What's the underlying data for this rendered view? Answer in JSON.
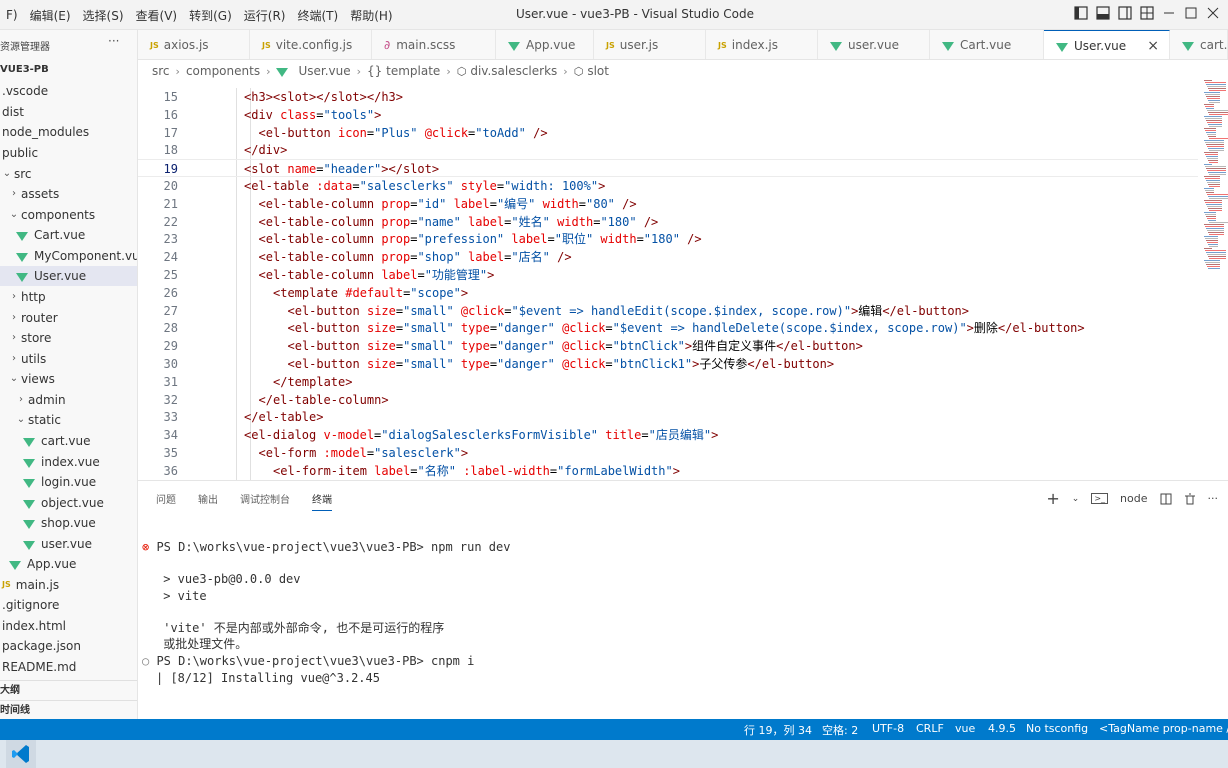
{
  "menu": [
    "F)",
    "编辑(E)",
    "选择(S)",
    "查看(V)",
    "转到(G)",
    "运行(R)",
    "终端(T)",
    "帮助(H)"
  ],
  "window_title": "User.vue - vue3-PB - Visual Studio Code",
  "sidebar": {
    "title": "资源管理器",
    "more": "···",
    "items": [
      {
        "label": "VUE3-PB",
        "kind": "root"
      },
      {
        "label": ".vscode",
        "kind": "folder"
      },
      {
        "label": "dist",
        "kind": "folder"
      },
      {
        "label": "node_modules",
        "kind": "folder"
      },
      {
        "label": "public",
        "kind": "folder"
      },
      {
        "label": "src",
        "kind": "folder"
      },
      {
        "label": "assets",
        "kind": "folder"
      },
      {
        "label": "components",
        "kind": "folder"
      },
      {
        "label": "Cart.vue",
        "kind": "vue"
      },
      {
        "label": "MyComponent.vue",
        "kind": "vue"
      },
      {
        "label": "User.vue",
        "kind": "vue"
      },
      {
        "label": "http",
        "kind": "folder"
      },
      {
        "label": "router",
        "kind": "folder"
      },
      {
        "label": "store",
        "kind": "folder"
      },
      {
        "label": "utils",
        "kind": "folder"
      },
      {
        "label": "views",
        "kind": "folder"
      },
      {
        "label": "admin",
        "kind": "folder"
      },
      {
        "label": "static",
        "kind": "folder"
      },
      {
        "label": "cart.vue",
        "kind": "vue"
      },
      {
        "label": "index.vue",
        "kind": "vue"
      },
      {
        "label": "login.vue",
        "kind": "vue"
      },
      {
        "label": "object.vue",
        "kind": "vue"
      },
      {
        "label": "shop.vue",
        "kind": "vue"
      },
      {
        "label": "user.vue",
        "kind": "vue"
      },
      {
        "label": "App.vue",
        "kind": "vue"
      },
      {
        "label": "main.js",
        "kind": "js"
      },
      {
        "label": ".gitignore",
        "kind": "file"
      },
      {
        "label": "index.html",
        "kind": "file"
      },
      {
        "label": "package.json",
        "kind": "file"
      },
      {
        "label": "README.md",
        "kind": "file"
      }
    ],
    "outline": "大纲",
    "timeline": "时间线"
  },
  "tabs": [
    {
      "label": "axios.js",
      "icon": "JS"
    },
    {
      "label": "vite.config.js",
      "icon": "JS"
    },
    {
      "label": "main.scss",
      "icon": "scss"
    },
    {
      "label": "App.vue",
      "icon": "vue"
    },
    {
      "label": "user.js",
      "icon": "JS"
    },
    {
      "label": "index.js",
      "icon": "JS"
    },
    {
      "label": "user.vue",
      "icon": "vue"
    },
    {
      "label": "Cart.vue",
      "icon": "vue"
    },
    {
      "label": "User.vue",
      "icon": "vue",
      "active": true
    },
    {
      "label": "cart.v",
      "icon": "vue"
    }
  ],
  "breadcrumb": [
    "src",
    "components",
    "User.vue",
    "{} template",
    "div.salesclerks",
    "slot"
  ],
  "code": [
    {
      "n": "15",
      "text": "<h3><slot></slot></h3>",
      "indent": 3
    },
    {
      "n": "16",
      "text": "<div class=\"tools\">",
      "indent": 3
    },
    {
      "n": "17",
      "text": "<el-button icon=\"Plus\" @click=\"toAdd\" />",
      "indent": 4
    },
    {
      "n": "18",
      "text": "</div>",
      "indent": 3
    },
    {
      "n": "19",
      "text": "<slot name=\"header\"></slot>",
      "indent": 3
    },
    {
      "n": "20",
      "text": "<el-table :data=\"salesclerks\" style=\"width: 100%\">",
      "indent": 3
    },
    {
      "n": "21",
      "text": "<el-table-column prop=\"id\" label=\"编号\" width=\"80\" />",
      "indent": 4
    },
    {
      "n": "22",
      "text": "<el-table-column prop=\"name\" label=\"姓名\" width=\"180\" />",
      "indent": 4
    },
    {
      "n": "23",
      "text": "<el-table-column prop=\"prefession\" label=\"职位\" width=\"180\" />",
      "indent": 4
    },
    {
      "n": "24",
      "text": "<el-table-column prop=\"shop\" label=\"店名\" />",
      "indent": 4
    },
    {
      "n": "25",
      "text": "<el-table-column label=\"功能管理\">",
      "indent": 4
    },
    {
      "n": "26",
      "text": "<template #default=\"scope\">",
      "indent": 5
    },
    {
      "n": "27",
      "text": "<el-button size=\"small\" @click=\"$event => handleEdit(scope.$index, scope.row)\">编辑</el-button>",
      "indent": 6
    },
    {
      "n": "28",
      "text": "<el-button size=\"small\" type=\"danger\" @click=\"$event => handleDelete(scope.$index, scope.row)\">删除</el-button>",
      "indent": 6
    },
    {
      "n": "29",
      "text": "<el-button size=\"small\" type=\"danger\" @click=\"btnClick\">组件自定义事件</el-button>",
      "indent": 6
    },
    {
      "n": "30",
      "text": "<el-button size=\"small\" type=\"danger\" @click=\"btnClick1\">子父传参</el-button>",
      "indent": 6
    },
    {
      "n": "31",
      "text": "</template>",
      "indent": 5
    },
    {
      "n": "32",
      "text": "</el-table-column>",
      "indent": 4
    },
    {
      "n": "33",
      "text": "</el-table>",
      "indent": 3
    },
    {
      "n": "34",
      "text": "<el-dialog v-model=\"dialogSalesclerksFormVisible\" title=\"店员编辑\">",
      "indent": 3
    },
    {
      "n": "35",
      "text": "<el-form :model=\"salesclerk\">",
      "indent": 4
    },
    {
      "n": "36",
      "text": "<el-form-item label=\"名称\" :label-width=\"formLabelWidth\">",
      "indent": 5
    }
  ],
  "current_line": "19",
  "panel": {
    "tabs": [
      "问题",
      "输出",
      "调试控制台",
      "终端"
    ],
    "active_tab": "终端",
    "shell": "node"
  },
  "terminal": [
    {
      "text": "PS D:\\works\\vue-project\\vue3\\vue3-PB> npm run dev",
      "marker": "error"
    },
    {
      "text": ""
    },
    {
      "text": " > vue3-pb@0.0.0 dev"
    },
    {
      "text": " > vite"
    },
    {
      "text": ""
    },
    {
      "text": " 'vite' 不是内部或外部命令, 也不是可运行的程序"
    },
    {
      "text": " 或批处理文件。"
    },
    {
      "text": "PS D:\\works\\vue-project\\vue3\\vue3-PB> cnpm i",
      "marker": "dot"
    },
    {
      "text": "| [8/12] Installing vue@^3.2.45"
    }
  ],
  "statusbar": {
    "position": "行 19，列 34",
    "spaces": "空格: 2",
    "encoding": "UTF-8",
    "eol": "CRLF",
    "language": "vue",
    "version": "4.9.5",
    "tsconfig": "No tsconfig",
    "tagname": "<TagName prop-name />"
  },
  "colors": {
    "accent": "#007acc",
    "vue": "#41b883",
    "js": "#c9a100",
    "tag": "#800000",
    "attr": "#e50000",
    "string": "#0451a5"
  }
}
